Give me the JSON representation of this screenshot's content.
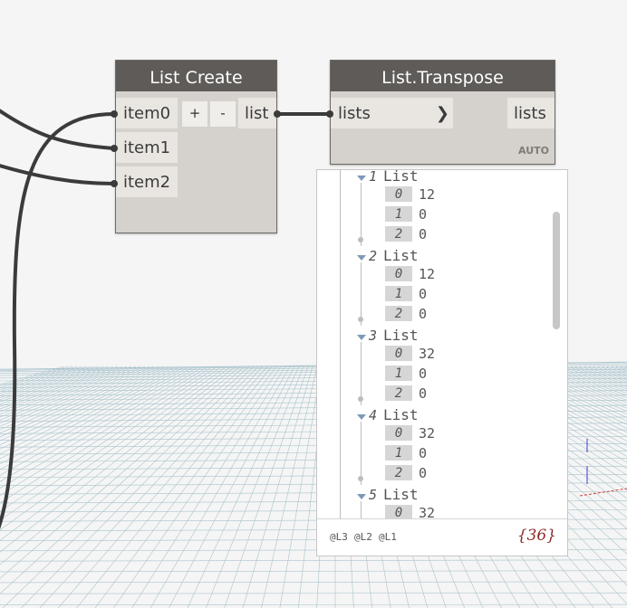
{
  "colors": {
    "node_header": "#5e5b58",
    "node_body": "#d5d1cc",
    "port": "#e9e6e2",
    "wire": "#3b3b3b",
    "grid": "#a9c3cc",
    "item_count": "#8d2a2a",
    "expand_triangle": "#7d99b8"
  },
  "list_create": {
    "title": "List Create",
    "inputs": [
      "item0",
      "item1",
      "item2"
    ],
    "add_label": "+",
    "remove_label": "-",
    "output": "list"
  },
  "list_transpose": {
    "title": "List.Transpose",
    "input": "lists",
    "arrow": "❯",
    "output": "lists",
    "lacing": "AUTO"
  },
  "preview": {
    "groups": [
      {
        "index": "1",
        "label": "List",
        "items": [
          {
            "idx": "0",
            "val": "12"
          },
          {
            "idx": "1",
            "val": "0"
          },
          {
            "idx": "2",
            "val": "0"
          }
        ]
      },
      {
        "index": "2",
        "label": "List",
        "items": [
          {
            "idx": "0",
            "val": "12"
          },
          {
            "idx": "1",
            "val": "0"
          },
          {
            "idx": "2",
            "val": "0"
          }
        ]
      },
      {
        "index": "3",
        "label": "List",
        "items": [
          {
            "idx": "0",
            "val": "32"
          },
          {
            "idx": "1",
            "val": "0"
          },
          {
            "idx": "2",
            "val": "0"
          }
        ]
      },
      {
        "index": "4",
        "label": "List",
        "items": [
          {
            "idx": "0",
            "val": "32"
          },
          {
            "idx": "1",
            "val": "0"
          },
          {
            "idx": "2",
            "val": "0"
          }
        ]
      },
      {
        "index": "5",
        "label": "List",
        "items": [
          {
            "idx": "0",
            "val": "32"
          }
        ]
      }
    ],
    "levels": [
      "@L3",
      "@L2",
      "@L1"
    ],
    "count": "{36}"
  }
}
